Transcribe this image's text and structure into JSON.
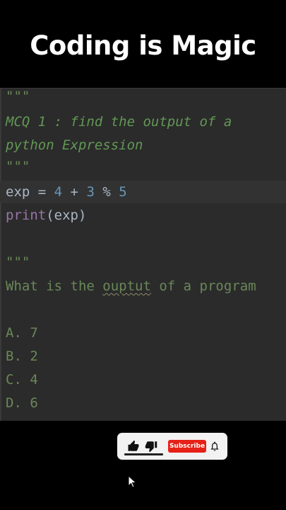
{
  "video": {
    "title": "Coding is Magic"
  },
  "code": {
    "lines": [
      "\"\"\"",
      "MCQ 1 : find the output of a",
      "python Expression",
      "\"\"\"",
      "",
      "",
      "",
      "\"\"\"",
      "What is the ouptut of a program",
      "",
      "A. 7",
      "B. 2",
      "C. 4",
      "D. 6"
    ],
    "expr": {
      "var": "exp",
      "eq": " = ",
      "a": "4",
      "plus": " + ",
      "b": "3",
      "mod": " % ",
      "c": "5"
    },
    "print": {
      "fn": "print",
      "open": "(",
      "arg": "exp",
      "close": ")"
    },
    "question": {
      "pre": "What is the ",
      "typo": "ouptut",
      "post": " of a program"
    }
  },
  "overlay": {
    "like_icon": "thumbs-up-icon",
    "dislike_icon": "thumbs-down-icon",
    "subscribe_label": "Subscribe",
    "bell_icon": "bell-icon",
    "cursor_icon": "pointer-cursor-icon"
  },
  "colors": {
    "background": "#000000",
    "editor_bg": "#2b2b2b",
    "comment": "#629755",
    "number": "#6897bb",
    "function": "#9876aa",
    "identifier": "#a9b7c6",
    "subscribe": "#e62117"
  }
}
